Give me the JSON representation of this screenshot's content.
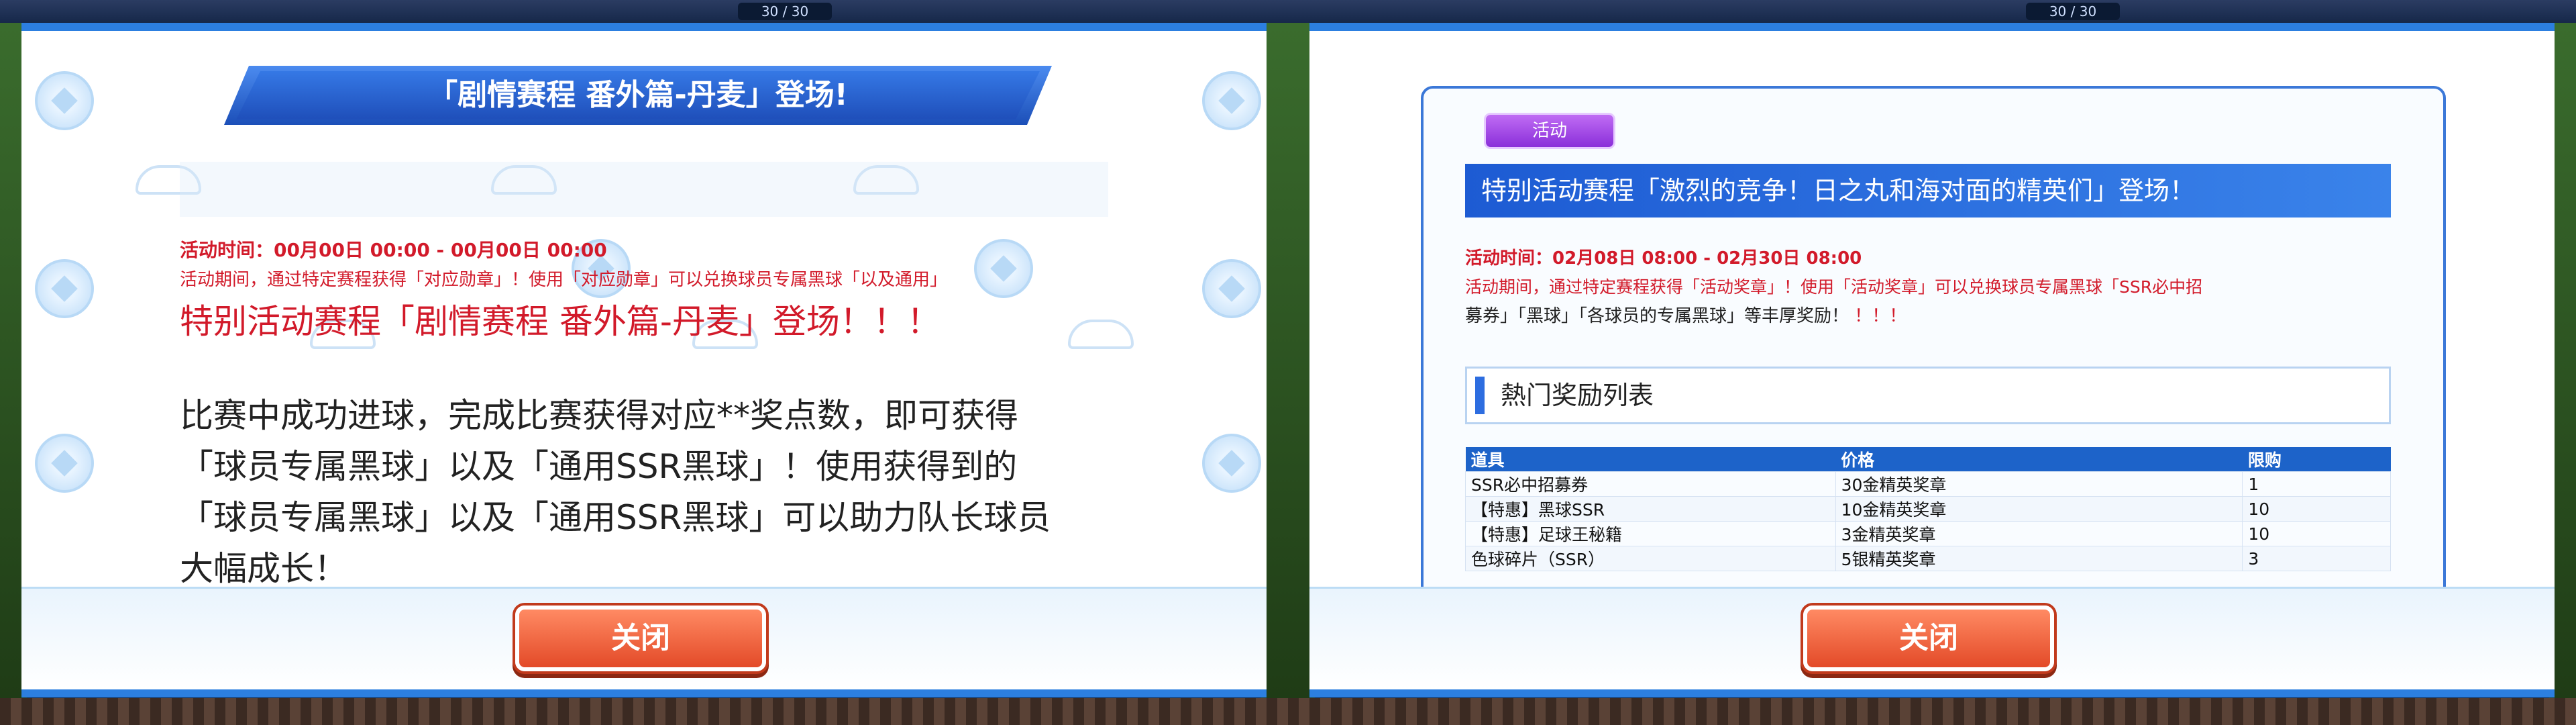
{
  "left": {
    "hud": {
      "counter": "30 / 30"
    },
    "banner_title": "「剧情赛程 番外篇-丹麦」登场!",
    "period": "活动时间：00月00日 00:00 - 00月00日 00:00",
    "desc_small": "活动期间，通过特定赛程获得「对应勋章」！使用「对应勋章」可以兑换球员专属黑球「以及通用」",
    "headline": "特别活动赛程「剧情赛程 番外篇-丹麦」登场！！！",
    "body_lines": [
      "比赛中成功进球，完成比赛获得对应**奖点数，即可获得",
      "「球员专属黑球」以及「通用SSR黑球」！使用获得到的",
      "「球员专属黑球」以及「通用SSR黑球」可以助力队长球员",
      "大幅成长！"
    ],
    "close_label": "关闭"
  },
  "right": {
    "hud": {
      "counter": "30 / 30"
    },
    "tag_label": "活动",
    "title": "特别活动赛程「激烈的竞争！日之丸和海对面的精英们」登场！",
    "period": "活动时间：02月08日 08:00 - 02月30日 08:00",
    "desc_line1": "活动期间，通过特定赛程获得「活动奖章」！使用「活动奖章」可以兑换球员专属黑球「SSR必中招",
    "desc_line2_a": "募券」「黑球」「各球员的专属黑球」等丰厚奖励！",
    "desc_line2_b": "！！！",
    "section_label": "熱门奖励列表",
    "table": {
      "headers": [
        "道具",
        "价格",
        "限购"
      ],
      "rows": [
        [
          "SSR必中招募券",
          "30金精英奖章",
          "1"
        ],
        [
          "【特惠】黑球SSR",
          "10金精英奖章",
          "10"
        ],
        [
          "【特惠】足球王秘籍",
          "3金精英奖章",
          "10"
        ],
        [
          "色球碎片（SSR）",
          "5银精英奖章",
          "3"
        ]
      ]
    },
    "close_label": "关闭"
  },
  "colors": {
    "accent_blue": "#2c7fe0",
    "red_text": "#d21a2a",
    "close_button": "#e34a28",
    "tag_purple": "#a14de6"
  }
}
